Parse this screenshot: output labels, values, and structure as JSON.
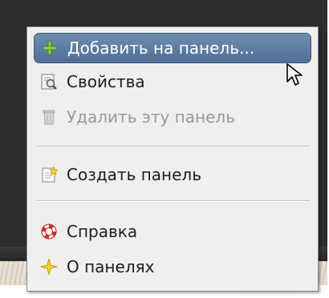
{
  "menu": {
    "items": [
      {
        "label": "Добавить на панель...",
        "icon": "plus-icon",
        "hovered": true,
        "enabled": true
      },
      {
        "label": "Свойства",
        "icon": "properties-icon",
        "enabled": true
      },
      {
        "label": "Удалить эту панель",
        "icon": "trash-icon",
        "enabled": false
      },
      {
        "label": "Создать панель",
        "icon": "new-panel-icon",
        "enabled": true
      },
      {
        "label": "Справка",
        "icon": "help-lifebuoy-icon",
        "enabled": true
      },
      {
        "label": "О панелях",
        "icon": "about-star-icon",
        "enabled": true
      }
    ]
  },
  "colors": {
    "highlight": "#5a7aa3",
    "menu_background": "#f1efed",
    "disabled_text": "#9a9a9a"
  }
}
